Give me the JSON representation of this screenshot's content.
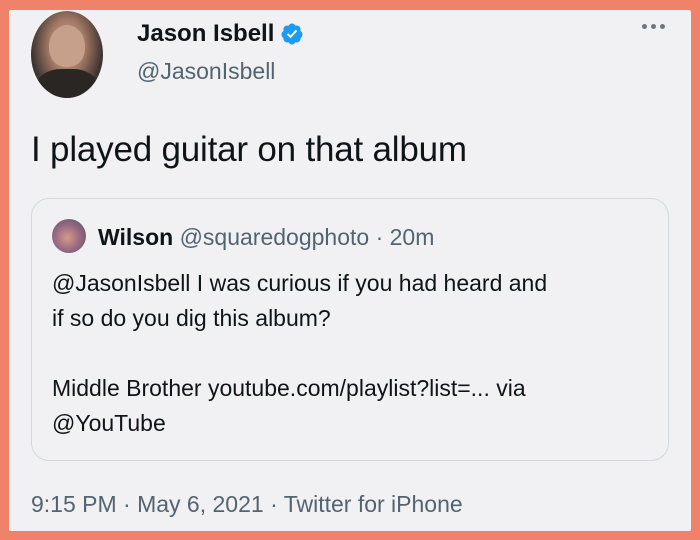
{
  "tweet": {
    "author_name": "Jason Isbell",
    "author_handle": "@JasonIsbell",
    "text": "I played guitar on that album",
    "timestamp": "9:15 PM · May 6, 2021 · Twitter for iPhone",
    "verified_icon": "verified-badge-icon",
    "more_icon": "more-options-icon"
  },
  "quote": {
    "author_name": "Wilson",
    "author_meta": "@squaredogphoto · 20m",
    "line1": "@JasonIsbell I was curious if you had heard and",
    "line2": "if so do you dig this album?",
    "line3": "Middle Brother youtube.com/playlist?list=... via",
    "line4": "@YouTube"
  },
  "colors": {
    "frame": "#f0826a",
    "background": "#f1f1f3",
    "verified": "#1d9bf0",
    "secondary_text": "#536471"
  }
}
